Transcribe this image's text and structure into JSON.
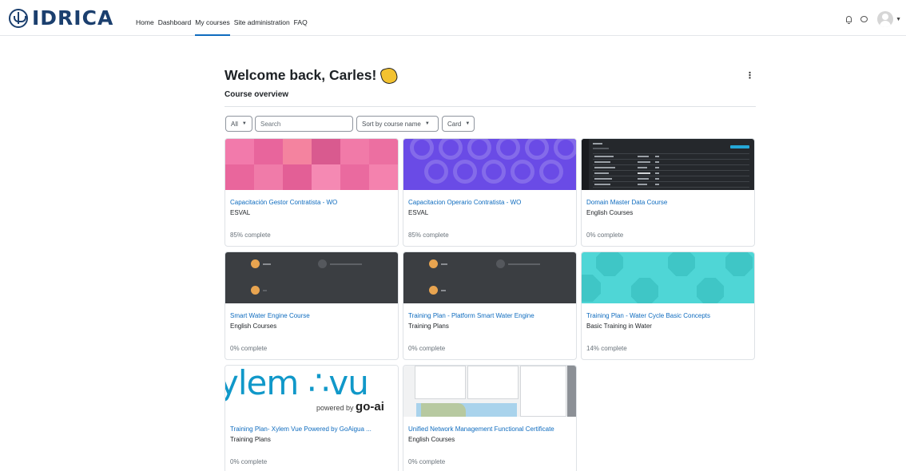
{
  "brand": {
    "name": "IDRICA"
  },
  "nav": {
    "links": [
      {
        "label": "Home",
        "active": false
      },
      {
        "label": "Dashboard",
        "active": false
      },
      {
        "label": "My courses",
        "active": true
      },
      {
        "label": "Site administration",
        "active": false
      },
      {
        "label": "FAQ",
        "active": false
      }
    ],
    "accent": "#0f6cbf"
  },
  "page": {
    "title": "Welcome back, Carles!",
    "section": "Course overview"
  },
  "filters": {
    "grouping": "All",
    "search_placeholder": "Search",
    "sort": "Sort by course name",
    "view": "Card"
  },
  "courses": [
    {
      "name": "Capacitación Gestor Contratista - WO",
      "category": "ESVAL",
      "progress": "85% complete",
      "image": "pink-squares"
    },
    {
      "name": "Capacitacion Operario Contratista - WO",
      "category": "ESVAL",
      "progress": "85% complete",
      "image": "purple-circles"
    },
    {
      "name": "Domain Master Data Course",
      "category": "English Courses",
      "progress": "0% complete",
      "image": "dark-table-screenshot"
    },
    {
      "name": "Smart Water Engine Course",
      "category": "English Courses",
      "progress": "0% complete",
      "image": "dark-menu-screenshot"
    },
    {
      "name": "Training Plan - Platform Smart Water Engine",
      "category": "Training Plans",
      "progress": "0% complete",
      "image": "dark-menu-screenshot"
    },
    {
      "name": "Training Plan - Water Cycle Basic Concepts",
      "category": "Basic Training in Water",
      "progress": "14% complete",
      "image": "cyan-octagons"
    },
    {
      "name": "Training Plan- Xylem Vue Powered by GoAigua ...",
      "category": "Training Plans",
      "progress": "0% complete",
      "image": "xylem-vue-logo"
    },
    {
      "name": "Unified Network Management Functional Certificate",
      "category": "English Courses",
      "progress": "0% complete",
      "image": "map-dashboard-screenshot"
    }
  ],
  "images": {
    "xylem_logo": "ylem ∴vu",
    "xylem_powered": "powered by",
    "xylem_goaigua": "go-ai"
  }
}
